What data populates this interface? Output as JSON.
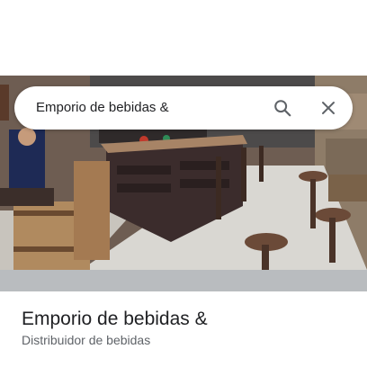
{
  "search": {
    "query": "Emporio de bebidas &"
  },
  "place": {
    "name": "Emporio de bebidas &",
    "category": "Distribuidor de bebidas"
  },
  "icons": {
    "search": "search-icon",
    "clear": "close-icon"
  },
  "colors": {
    "title_text": "#202124",
    "secondary_text": "#5f6368",
    "icon": "#5f6368"
  }
}
